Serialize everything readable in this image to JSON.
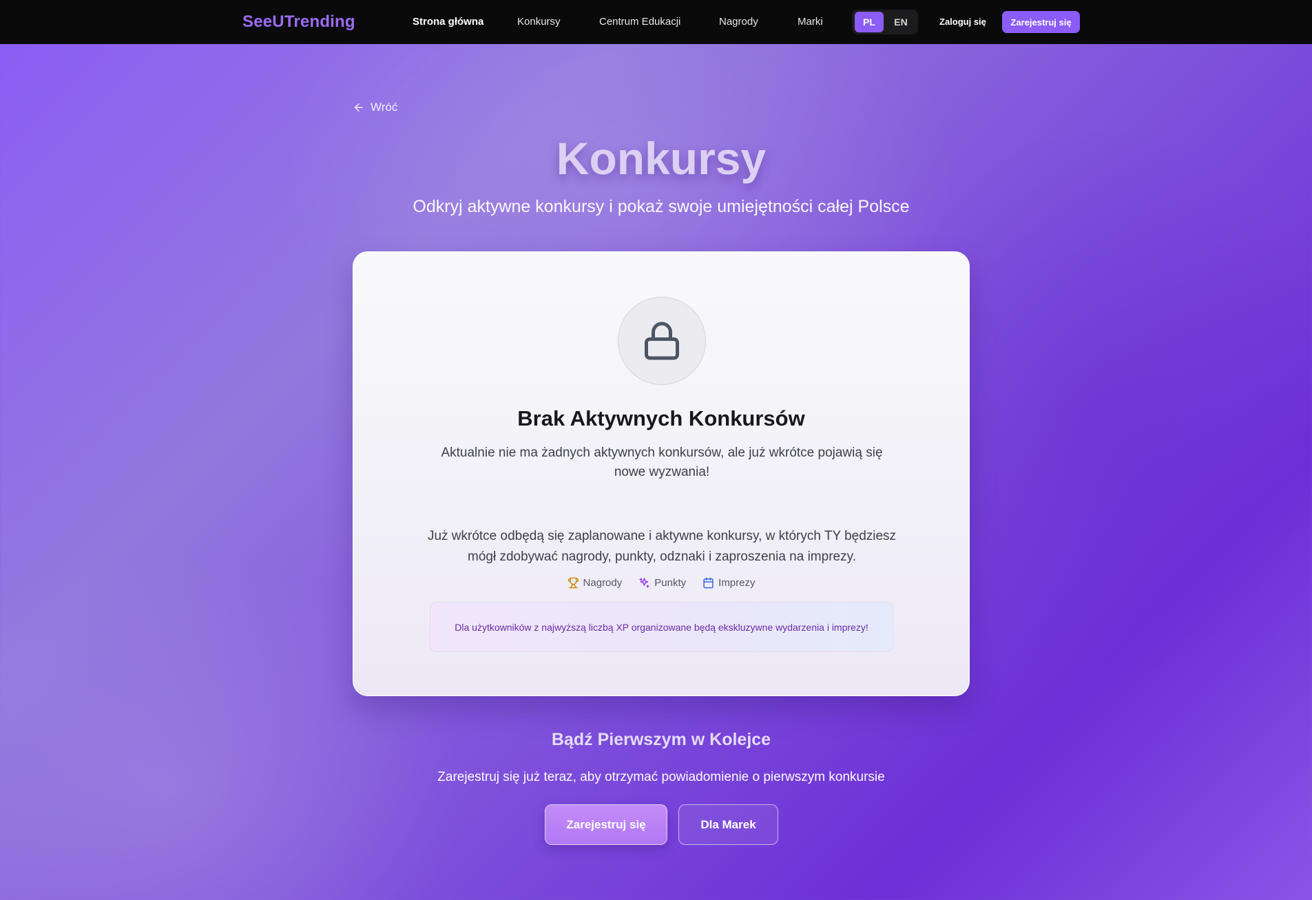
{
  "nav": {
    "brand": "SeeUTrending",
    "links": [
      "Strona główna",
      "Konkursy",
      "Centrum Edukacji",
      "Nagrody",
      "Marki"
    ],
    "lang": [
      "PL",
      "EN"
    ],
    "active_lang": "PL",
    "login": "Zaloguj się",
    "register": "Zarejestruj się"
  },
  "back": {
    "label": "Wróć",
    "icon": "arrow-left-icon"
  },
  "hero": {
    "title": "Konkursy",
    "subtitle": "Odkryj aktywne konkursy i pokaż swoje umiejętności całej Polsce"
  },
  "card": {
    "icon": "lock-icon",
    "title": "Brak Aktywnych Konkursów",
    "description": "Aktualnie nie ma żadnych aktywnych konkursów, ale już wkrótce pojawią się nowe wyzwania!",
    "description2": "Już wkrótce odbędą się zaplanowane i aktywne konkursy, w których TY będziesz mógł zdobywać nagrody, punkty, odznaki i zaproszenia na imprezy.",
    "perks": [
      {
        "label": "Nagrody",
        "icon": "trophy-icon",
        "color": "#ca8a04"
      },
      {
        "label": "Punkty",
        "icon": "sparkles-icon",
        "color": "#9333ea"
      },
      {
        "label": "Imprezy",
        "icon": "calendar-icon",
        "color": "#2563eb"
      }
    ],
    "notice": "Dla użytkowników z najwyższą liczbą XP organizowane będą ekskluzywne wydarzenia i imprezy!"
  },
  "cta": {
    "title": "Bądź Pierwszym w Kolejce",
    "subtitle": "Zarejestruj się już teraz, aby otrzymać powiadomienie o pierwszym konkursie",
    "primary": "Zarejestruj się",
    "secondary": "Dla Marek"
  },
  "colors": {
    "accent": "#8b5cf6",
    "nav_bg": "#0a0a0a"
  }
}
